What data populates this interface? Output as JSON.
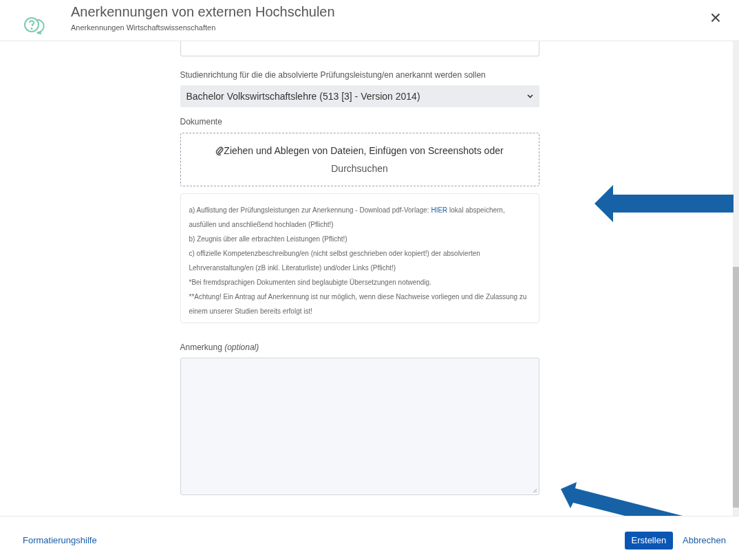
{
  "header": {
    "title": "Anerkennungen von externen Hochschulen",
    "subtitle": "Anerkennungen Wirtschaftswissenschaften",
    "close": "×"
  },
  "form": {
    "study_label": "Studienrichtung für die die absolvierte Prüfungsleistung/en anerkannt werden sollen",
    "study_value": "Bachelor Volkswirtschaftslehre (513 [3] - Version 2014)",
    "documents_label": "Dokumente",
    "dropzone": {
      "text": "Ziehen und Ablegen von Dateien, Einfügen von Screenshots oder",
      "browse": "Durchsuchen"
    },
    "info": [
      {
        "text": "a) Auflistung der Prüfungsleistungen zur Anerkennung - Download pdf-Vorlage:",
        "link": "HIER",
        "after": "lokal abspeichern, ausfüllen und anschließend hochladen (Pflicht!)"
      },
      {
        "text": "b) Zeugnis über alle erbrachten Leistungen (Pflicht!)"
      },
      {
        "text": "c) offizielle Kompetenzbeschreibung/en (nicht selbst geschrieben oder kopiert!) der absolvierten Lehrveranstaltung/en (zB inkl. Literaturliste) und/oder Links (Pflicht!)"
      },
      {
        "text": "*Bei fremdsprachigen Dokumenten sind beglaubigte Übersetzungen notwendig."
      },
      {
        "text": "**Achtung! Ein Antrag auf Anerkennung ist nur möglich, wenn diese Nachweise vorliegen und die Zulassung zu einem unserer Studien bereits erfolgt ist!"
      }
    ],
    "remark_label": "Anmerkung *(optional)*"
  },
  "footer": {
    "help_link": "Formatierungshilfe",
    "buttons": [
      {
        "label": "Erstellen",
        "kind": "primary"
      },
      {
        "label": "Abbrechen",
        "kind": "link"
      }
    ]
  }
}
